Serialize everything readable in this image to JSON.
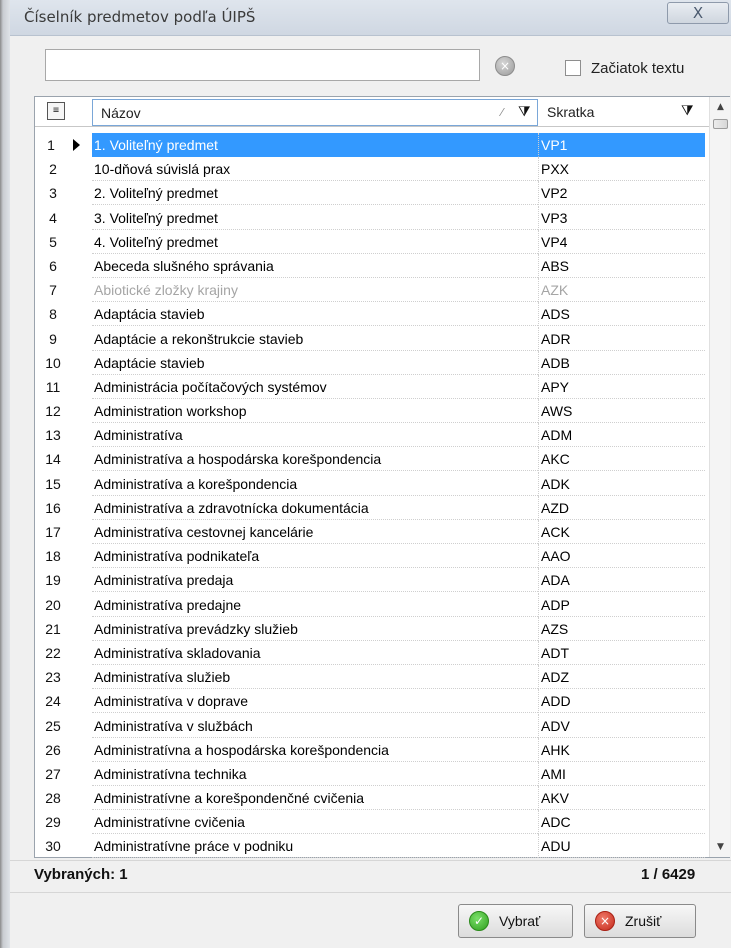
{
  "window": {
    "title": "Číselník predmetov podľa ÚIPŠ",
    "close_label": "X"
  },
  "search": {
    "value": "",
    "placeholder": "",
    "clear_glyph": "×",
    "starts_with_label": "Začiatok textu",
    "starts_with_checked": false
  },
  "grid": {
    "col_chooser_glyph": "≡",
    "columns": {
      "name": "Názov",
      "abbr": "Skratka"
    },
    "sort_glyph": "⁄",
    "filter_glyph": "⧩",
    "selected_row_index": 0,
    "disabled_row_index": 6,
    "rows": [
      {
        "num": "1",
        "name": "1. Voliteľný predmet",
        "abbr": "VP1"
      },
      {
        "num": "2",
        "name": "10-dňová súvislá prax",
        "abbr": "PXX"
      },
      {
        "num": "3",
        "name": "2. Voliteľný predmet",
        "abbr": "VP2"
      },
      {
        "num": "4",
        "name": "3. Voliteľný predmet",
        "abbr": "VP3"
      },
      {
        "num": "5",
        "name": "4. Voliteľný predmet",
        "abbr": "VP4"
      },
      {
        "num": "6",
        "name": "Abeceda slušného správania",
        "abbr": "ABS"
      },
      {
        "num": "7",
        "name": "Abiotické zložky krajiny",
        "abbr": "AZK"
      },
      {
        "num": "8",
        "name": "Adaptácia stavieb",
        "abbr": "ADS"
      },
      {
        "num": "9",
        "name": "Adaptácie a rekonštrukcie stavieb",
        "abbr": "ADR"
      },
      {
        "num": "10",
        "name": "Adaptácie stavieb",
        "abbr": "ADB"
      },
      {
        "num": "11",
        "name": "Administrácia počítačových systémov",
        "abbr": "APY"
      },
      {
        "num": "12",
        "name": "Administration workshop",
        "abbr": "AWS"
      },
      {
        "num": "13",
        "name": "Administratíva",
        "abbr": "ADM"
      },
      {
        "num": "14",
        "name": "Administratíva a hospodárska korešpondencia",
        "abbr": "AKC"
      },
      {
        "num": "15",
        "name": "Administratíva a korešpondencia",
        "abbr": "ADK"
      },
      {
        "num": "16",
        "name": "Administratíva a zdravotnícka dokumentácia",
        "abbr": "AZD"
      },
      {
        "num": "17",
        "name": "Administratíva cestovnej kancelárie",
        "abbr": "ACK"
      },
      {
        "num": "18",
        "name": "Administratíva podnikateľa",
        "abbr": "AAO"
      },
      {
        "num": "19",
        "name": "Administratíva predaja",
        "abbr": "ADA"
      },
      {
        "num": "20",
        "name": "Administratíva predajne",
        "abbr": "ADP"
      },
      {
        "num": "21",
        "name": "Administratíva prevádzky služieb",
        "abbr": "AZS"
      },
      {
        "num": "22",
        "name": "Administratíva skladovania",
        "abbr": "ADT"
      },
      {
        "num": "23",
        "name": "Administratíva služieb",
        "abbr": "ADZ"
      },
      {
        "num": "24",
        "name": "Administratíva v doprave",
        "abbr": "ADD"
      },
      {
        "num": "25",
        "name": "Administratíva v službách",
        "abbr": "ADV"
      },
      {
        "num": "26",
        "name": "Administratívna a hospodárska korešpondencia",
        "abbr": "AHK"
      },
      {
        "num": "27",
        "name": "Administratívna technika",
        "abbr": "AMI"
      },
      {
        "num": "28",
        "name": "Administratívne a korešpondenčné cvičenia",
        "abbr": "AKV"
      },
      {
        "num": "29",
        "name": "Administratívne cvičenia",
        "abbr": "ADC"
      },
      {
        "num": "30",
        "name": "Administratívne práce v podniku",
        "abbr": "ADU"
      }
    ]
  },
  "status": {
    "selected_label": "Vybraných: 1",
    "position": "1 / 6429"
  },
  "buttons": {
    "ok_label": "Vybrať",
    "ok_glyph": "✓",
    "cancel_label": "Zrušiť",
    "cancel_glyph": "×"
  },
  "colors": {
    "selection": "#3399ff",
    "disabled_text": "#a5a5a5"
  }
}
